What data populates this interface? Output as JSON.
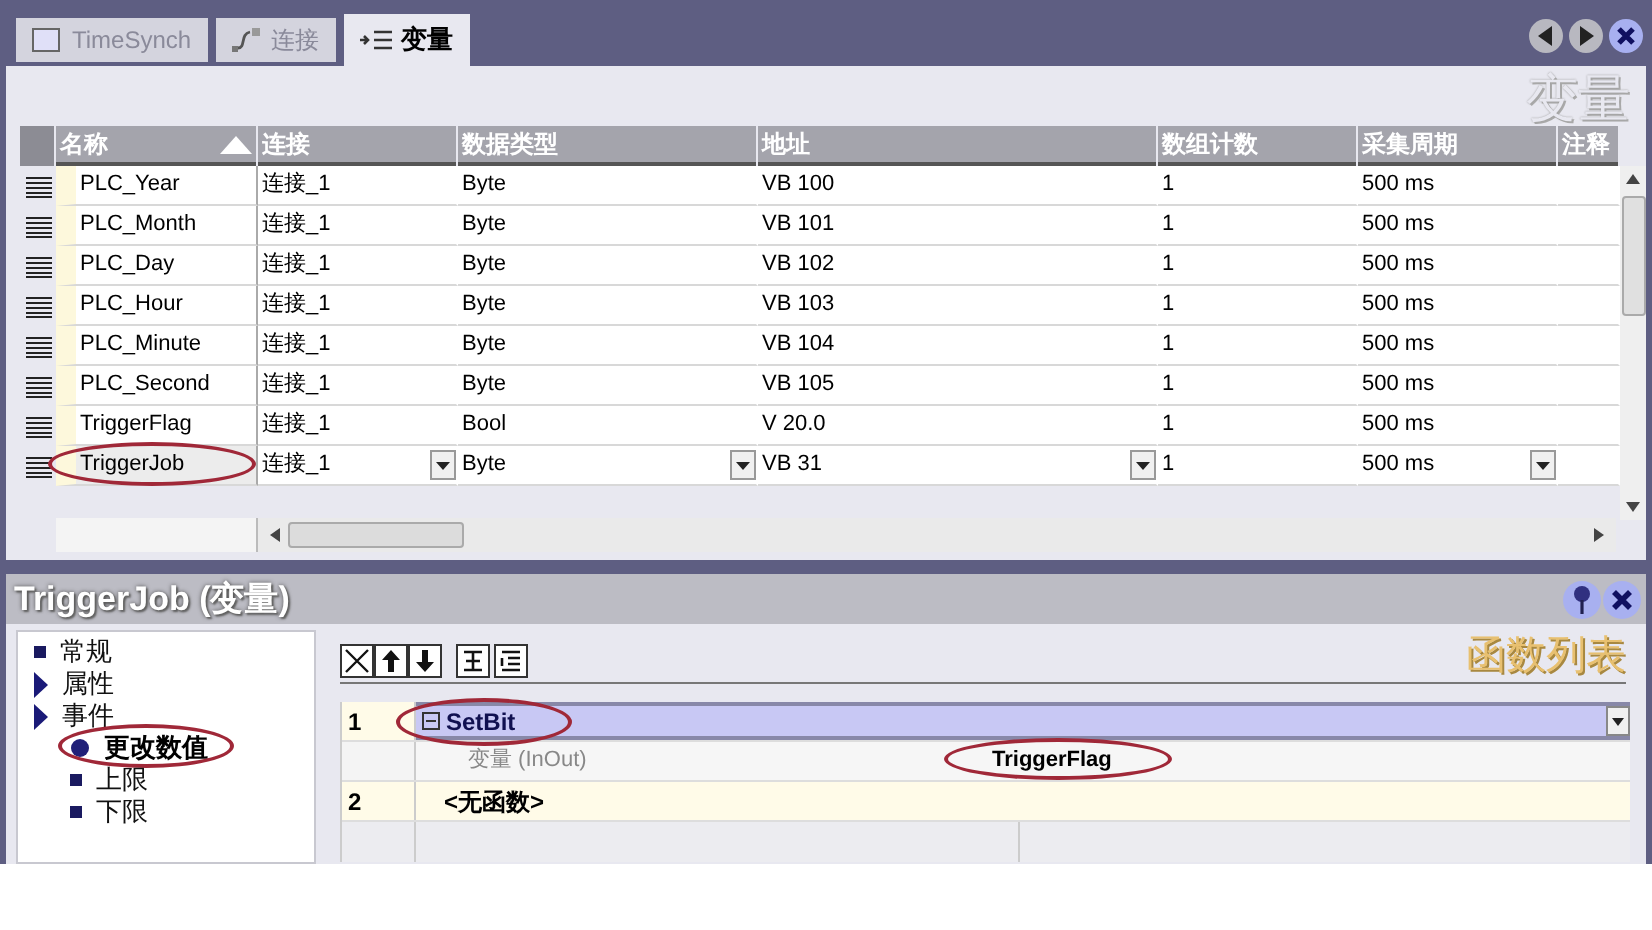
{
  "tabs": [
    {
      "label": "TimeSynch",
      "selected": false
    },
    {
      "label": "连接",
      "selected": false
    },
    {
      "label": "变量",
      "selected": true
    }
  ],
  "editor": {
    "heading": "变量",
    "columns": [
      {
        "label": "名称",
        "sorted": true
      },
      {
        "label": "连接",
        "sorted": false
      },
      {
        "label": "数据类型",
        "sorted": false
      },
      {
        "label": "地址",
        "sorted": false
      },
      {
        "label": "数组计数",
        "sorted": false
      },
      {
        "label": "采集周期",
        "sorted": false
      },
      {
        "label": "注释",
        "sorted": false
      }
    ],
    "rows": [
      {
        "cells": [
          "PLC_Year",
          "连接_1",
          "Byte",
          "VB 100",
          "1",
          "500 ms"
        ],
        "editing": false,
        "annotated": false
      },
      {
        "cells": [
          "PLC_Month",
          "连接_1",
          "Byte",
          "VB 101",
          "1",
          "500 ms"
        ],
        "editing": false,
        "annotated": false
      },
      {
        "cells": [
          "PLC_Day",
          "连接_1",
          "Byte",
          "VB 102",
          "1",
          "500 ms"
        ],
        "editing": false,
        "annotated": false
      },
      {
        "cells": [
          "PLC_Hour",
          "连接_1",
          "Byte",
          "VB 103",
          "1",
          "500 ms"
        ],
        "editing": false,
        "annotated": false
      },
      {
        "cells": [
          "PLC_Minute",
          "连接_1",
          "Byte",
          "VB 104",
          "1",
          "500 ms"
        ],
        "editing": false,
        "annotated": false
      },
      {
        "cells": [
          "PLC_Second",
          "连接_1",
          "Byte",
          "VB 105",
          "1",
          "500 ms"
        ],
        "editing": false,
        "annotated": false
      },
      {
        "cells": [
          "TriggerFlag",
          "连接_1",
          "Bool",
          "V 20.0",
          "1",
          "500 ms"
        ],
        "editing": false,
        "annotated": false
      },
      {
        "cells": [
          "TriggerJob",
          "连接_1",
          "Byte",
          "VB 31",
          "1",
          "500 ms"
        ],
        "editing": true,
        "annotated": true
      }
    ]
  },
  "properties": {
    "title": "TriggerJob (变量)",
    "tree": [
      {
        "label": "常规",
        "expandable": false,
        "selected": false,
        "annotated": false
      },
      {
        "label": "属性",
        "expandable": true,
        "selected": false,
        "annotated": false
      },
      {
        "label": "事件",
        "expandable": true,
        "selected": false,
        "annotated": false,
        "children": [
          {
            "label": "更改数值",
            "expandable": false,
            "selected": true,
            "annotated": true
          },
          {
            "label": "上限",
            "expandable": false,
            "selected": false,
            "annotated": false
          },
          {
            "label": "下限",
            "expandable": false,
            "selected": false,
            "annotated": false
          }
        ]
      }
    ],
    "heading": "函数列表",
    "functions": [
      {
        "number": "1",
        "name": "SetBit",
        "kind": "function",
        "expanded": true,
        "annotated": true,
        "params": [
          {
            "label": "变量 (InOut)",
            "value": "TriggerFlag",
            "annotated": true
          }
        ]
      },
      {
        "number": "2",
        "name": "<无函数>",
        "kind": "empty"
      }
    ]
  }
}
